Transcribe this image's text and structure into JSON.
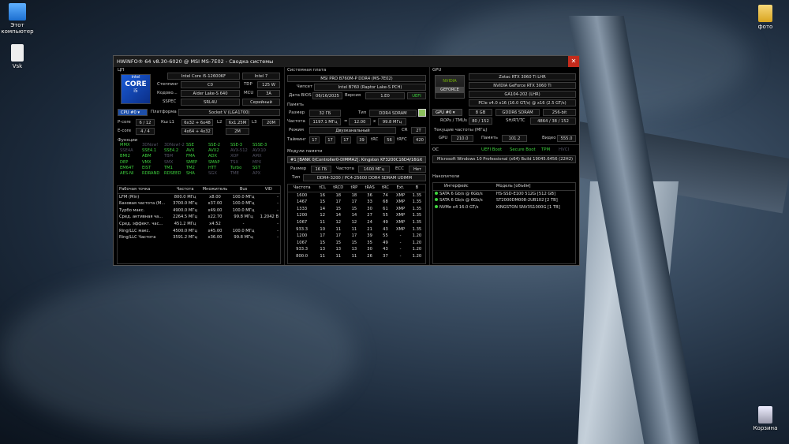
{
  "desktop": {
    "icons": [
      {
        "label": "Этот компьютер"
      },
      {
        "label": "Vsk"
      },
      {
        "label": "фото"
      },
      {
        "label": "Корзина"
      }
    ]
  },
  "window": {
    "title": "HWiNFO® 64 v8.30-6020 @ MSI MS-7E02 - Сводка системы"
  },
  "cpu": {
    "header": "ЦП",
    "brand_small": "intel",
    "brand_big": "CORE",
    "brand_tier": "i5",
    "name": "Intel Core i5-12600KF",
    "family": "Intel 7",
    "stepping_label": "Степпинг",
    "stepping": "C0",
    "tdp_label": "TDP",
    "tdp": "125 W",
    "codename_label": "Кодово...",
    "codename": "Alder Lake-S 640",
    "mcu_label": "MCU",
    "mcu": "3A",
    "sspec_label": "SSPEC",
    "sspec": "SRL4U",
    "serial": "Серийный",
    "select": "CPU #0",
    "platform_label": "Платформа",
    "platform": "Socket V (LGA1700)",
    "pcore_label": "P-core",
    "pcore": "6 / 12",
    "l1_label": "Кш L1",
    "l1": "6x32 + 6x48",
    "l2_label": "L2",
    "l2": "6x1.25M",
    "l3_label": "L3",
    "l3": "20M",
    "ecore_label": "E-core",
    "ecore": "4 / 4",
    "l1e": "4x64 + 4x32",
    "l2e": "2M",
    "features_label": "Функции",
    "features": [
      [
        "MMX",
        "g"
      ],
      [
        "3DNow!",
        "dg"
      ],
      [
        "3DNow!-2",
        "dg"
      ],
      [
        "SSE",
        "g"
      ],
      [
        "SSE-2",
        "g"
      ],
      [
        "SSE-3",
        "g"
      ],
      [
        "SSSE-3",
        "g"
      ],
      [
        "SSE4A",
        "dg"
      ],
      [
        "SSE4.1",
        "g"
      ],
      [
        "SSE4.2",
        "g"
      ],
      [
        "AVX",
        "g"
      ],
      [
        "AVX2",
        "g"
      ],
      [
        "AVX-512",
        "dg"
      ],
      [
        "AVX10",
        "dg"
      ],
      [
        "BMI2",
        "g"
      ],
      [
        "ABM",
        "g"
      ],
      [
        "TBM",
        "dg"
      ],
      [
        "FMA",
        "g"
      ],
      [
        "ADX",
        "g"
      ],
      [
        "XOP",
        "dg"
      ],
      [
        "AMX",
        "dg"
      ],
      [
        "DEP",
        "g"
      ],
      [
        "VMX",
        "g"
      ],
      [
        "SMX",
        "dg"
      ],
      [
        "SMEP",
        "g"
      ],
      [
        "SMAP",
        "g"
      ],
      [
        "TSX",
        "dg"
      ],
      [
        "MPX",
        "dg"
      ],
      [
        "EM64T",
        "g"
      ],
      [
        "EIST",
        "g"
      ],
      [
        "TM1",
        "g"
      ],
      [
        "TM2",
        "g"
      ],
      [
        "HTT",
        "g"
      ],
      [
        "Turbo",
        "g"
      ],
      [
        "SST",
        "g"
      ],
      [
        "AES-NI",
        "g"
      ],
      [
        "RDRAND",
        "g"
      ],
      [
        "RDSEED",
        "g"
      ],
      [
        "SHA",
        "g"
      ],
      [
        "SGX",
        "dg"
      ],
      [
        "TME",
        "dg"
      ],
      [
        "APX",
        "dg"
      ]
    ],
    "op_headers": [
      "Рабочая точка",
      "Частота",
      "Множитель",
      "Bus",
      "VID"
    ],
    "op_rows": [
      [
        "LFM (Min)",
        "800.0 МГц",
        "x8.00",
        "100.0 МГц",
        "-"
      ],
      [
        "Базовая частота (M...",
        "3700.0 МГц",
        "x37.00",
        "100.0 МГц",
        "-"
      ],
      [
        "Турбо макс.",
        "4900.0 МГц",
        "x49.00",
        "100.0 МГц",
        "-"
      ],
      [
        "Сред. активная ча...",
        "2264.5 МГц",
        "x22.70",
        "99.8 МГц",
        "1.2042 В"
      ],
      [
        "Сред. эффект. час...",
        "451.2 МГц",
        "x4.52",
        "-",
        "-"
      ],
      [
        "Ring/LLC макс.",
        "4500.0 МГц",
        "x45.00",
        "100.0 МГц",
        "-"
      ],
      [
        "Ring/LLC Частота",
        "3591.2 МГц",
        "x36.00",
        "99.8 МГц",
        "-"
      ]
    ]
  },
  "mb": {
    "header": "Системная плата",
    "name": "MSI PRO B760M-P DDR4 (MS-7E02)",
    "chipset_label": "Чипсет",
    "chipset": "Intel B760 (Raptor Lake-S PCH)",
    "bios_label": "Дата BIOS",
    "bios_date": "06/16/2025",
    "version_label": "Версия",
    "version": "1.E0",
    "uefi": "UEFI"
  },
  "memory": {
    "header": "Память",
    "size_label": "Размер",
    "size": "32 ГБ",
    "type_label": "Тип",
    "type": "DDR4 SDRAM",
    "freq_label": "Частота",
    "freq": "1197.1 МГц",
    "eq": "=",
    "mult": "12.00",
    "x": "x",
    "bus": "99.8 МГц",
    "mode_label": "Режим",
    "mode": "Двухканальный",
    "cr_label": "CR",
    "cr": "2T",
    "timing_label": "Тайминг",
    "timings": [
      "17",
      "17",
      "17",
      "39"
    ],
    "trc_label": "tRC",
    "trc": "56",
    "trfc_label": "tRFC",
    "trfc": "420"
  },
  "modules": {
    "header": "Модули памяти",
    "select": "#1 [BANK 0/Controller0-DIMMA2]: Kingston KF3200C16D4/16GX",
    "size_label": "Размер",
    "size": "16 ГБ",
    "freq_label": "Частота",
    "freq": "1600 МГц",
    "ecc_label": "ECC",
    "ecc": "Нет",
    "type_label": "Тип",
    "type": "DDR4-3200 / PC4-25600 DDR4 SDRAM UDIMM",
    "headers": [
      "Частота",
      "tCL",
      "tRCD",
      "tRP",
      "tRAS",
      "tRC",
      "Ext.",
      "В"
    ],
    "rows": [
      [
        "1600",
        "16",
        "18",
        "18",
        "36",
        "74",
        "XMP",
        "1.35"
      ],
      [
        "1467",
        "15",
        "17",
        "17",
        "33",
        "68",
        "XMP",
        "1.35"
      ],
      [
        "1333",
        "14",
        "15",
        "15",
        "30",
        "61",
        "XMP",
        "1.35"
      ],
      [
        "1200",
        "12",
        "14",
        "14",
        "27",
        "55",
        "XMP",
        "1.35"
      ],
      [
        "1067",
        "11",
        "12",
        "12",
        "24",
        "49",
        "XMP",
        "1.35"
      ],
      [
        "933.3",
        "10",
        "11",
        "11",
        "21",
        "43",
        "XMP",
        "1.35"
      ],
      [
        "1200",
        "17",
        "17",
        "17",
        "39",
        "55",
        "-",
        "1.20"
      ],
      [
        "1067",
        "15",
        "15",
        "15",
        "35",
        "49",
        "-",
        "1.20"
      ],
      [
        "933.3",
        "13",
        "13",
        "13",
        "30",
        "43",
        "-",
        "1.20"
      ],
      [
        "800.0",
        "11",
        "11",
        "11",
        "26",
        "37",
        "-",
        "1.20"
      ]
    ]
  },
  "gpu": {
    "header": "GPU",
    "logo_brand": "NVIDIA",
    "logo_line": "GEFORCE",
    "vendor_name": "Zotac RTX 3060 Ti LHR",
    "name": "NVIDIA GeForce RTX 3060 Ti",
    "chip": "GA104-202 (LHR)",
    "pcie": "PCIe v4.0 x16 (16.0 GT/s) @ x16 (2.5 GT/s)",
    "select": "GPU #0",
    "vram": "8 GB",
    "vram_type": "GDDR6 SDRAM",
    "bus_width": "256-bit",
    "rops_label": "ROPs / TMUs",
    "rops": "80 / 152",
    "sh_label": "SH/RT/TC",
    "sh": "4864 / 38 / 152",
    "clocks_label": "Текущие частоты (МГц)",
    "gpu_label": "GPU",
    "gpu_clock": "210.0",
    "mem_label": "Память",
    "mem_clock": "101.2",
    "video_label": "Видео",
    "video_clock": "555.0"
  },
  "os": {
    "header": "ОС",
    "uefi_boot": "UEFI Boot",
    "secure_boot": "Secure Boot",
    "tpm": "TPM",
    "hvci": "HVCI",
    "name": "Microsoft Windows 10 Professional (x64) Build 19045.6456 (22H2)"
  },
  "drives": {
    "header": "Накопители",
    "headers": [
      "Интерфейс",
      "Модель [объём]"
    ],
    "rows": [
      [
        "SATA 6 Gb/s @ 6Gb/s",
        "HS-SSD-E100 512G [512 GB]"
      ],
      [
        "SATA 6 Gb/s @ 6Gb/s",
        "ST2000DM008-2UB102 [2 TB]"
      ],
      [
        "NVMe x4 16.0 GT/s",
        "KINGSTON SNV3S1000G [1 TB]"
      ]
    ]
  },
  "colors": {
    "accent": "#1e4fa8",
    "ok_green": "#3fd43f",
    "close": "#c42b1c"
  }
}
